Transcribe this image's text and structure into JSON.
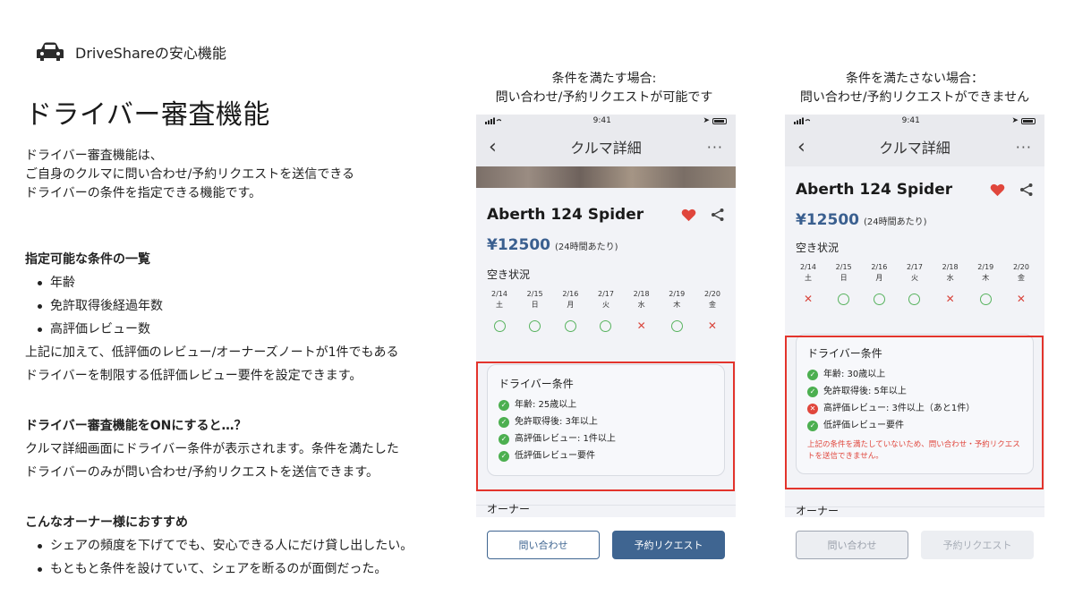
{
  "brand": {
    "name": "DriveShareの安心機能",
    "icon": "car-icon"
  },
  "page_title": "ドライバー審査機能",
  "intro": [
    "ドライバー審査機能は、",
    "ご自身のクルマに問い合わせ/予約リクエストを送信できる",
    "ドライバーの条件を指定できる機能です。"
  ],
  "section1": {
    "heading": "指定可能な条件の一覧",
    "items": [
      "年齢",
      "免許取得後経過年数",
      "高評価レビュー数"
    ],
    "notes": [
      "上記に加えて、低評価のレビュー/オーナーズノートが1件でもある",
      "ドライバーを制限する低評価レビュー要件を設定できます。"
    ]
  },
  "section2": {
    "heading": "ドライバー審査機能をONにすると…？",
    "lines": [
      "クルマ詳細画面にドライバー条件が表示されます。条件を満たした",
      "ドライバーのみが問い合わせ/予約リクエストを送信できます。"
    ]
  },
  "section3": {
    "heading": "こんなオーナー様におすすめ",
    "items": [
      "シェアの頻度を下げてでも、安心できる人にだけ貸し出したい。",
      "もともと条件を設けていて、シェアを断るのが面倒だった。"
    ]
  },
  "phone1": {
    "caption": [
      "条件を満たす場合:",
      "問い合わせ/予約リクエストが可能です"
    ],
    "time": "9:41",
    "nav_title": "クルマ詳細",
    "back": "‹",
    "more": "···",
    "car_name": "Aberth 124 Spider",
    "price": "¥12500",
    "price_note": "(24時間あたり)",
    "avail_label": "空き状況",
    "days": [
      {
        "date": "2/14",
        "dow": "土",
        "ok": true
      },
      {
        "date": "2/15",
        "dow": "日",
        "ok": true
      },
      {
        "date": "2/16",
        "dow": "月",
        "ok": true
      },
      {
        "date": "2/17",
        "dow": "火",
        "ok": true
      },
      {
        "date": "2/18",
        "dow": "水",
        "ok": false
      },
      {
        "date": "2/19",
        "dow": "木",
        "ok": true
      },
      {
        "date": "2/20",
        "dow": "金",
        "ok": false
      }
    ],
    "cond_title": "ドライバー条件",
    "conditions": [
      {
        "text": "年齢: 25歳以上",
        "ok": true
      },
      {
        "text": "免許取得後: 3年以上",
        "ok": true
      },
      {
        "text": "高評価レビュー: 1件以上",
        "ok": true
      },
      {
        "text": "低評価レビュー要件",
        "ok": true
      }
    ],
    "owner_label": "オーナー",
    "btn_inquiry": "問い合わせ",
    "btn_request": "予約リクエスト"
  },
  "phone2": {
    "caption": [
      "条件を満たさない場合：",
      "問い合わせ/予約リクエストができません"
    ],
    "time": "9:41",
    "nav_title": "クルマ詳細",
    "back": "‹",
    "more": "···",
    "car_name": "Aberth 124 Spider",
    "price": "¥12500",
    "price_note": "(24時間あたり)",
    "avail_label": "空き状況",
    "days": [
      {
        "date": "2/14",
        "dow": "土",
        "ok": false
      },
      {
        "date": "2/15",
        "dow": "日",
        "ok": true
      },
      {
        "date": "2/16",
        "dow": "月",
        "ok": true
      },
      {
        "date": "2/17",
        "dow": "火",
        "ok": true
      },
      {
        "date": "2/18",
        "dow": "水",
        "ok": false
      },
      {
        "date": "2/19",
        "dow": "木",
        "ok": true
      },
      {
        "date": "2/20",
        "dow": "金",
        "ok": false
      }
    ],
    "cond_title": "ドライバー条件",
    "conditions": [
      {
        "text": "年齢: 30歳以上",
        "ok": true
      },
      {
        "text": "免許取得後: 5年以上",
        "ok": true
      },
      {
        "text": "高評価レビュー: 3件以上（あと1件）",
        "ok": false
      },
      {
        "text": "低評価レビュー要件",
        "ok": true
      }
    ],
    "warning": "上記の条件を満たしていないため、問い合わせ・予約リクエストを送信できません。",
    "owner_label": "オーナー",
    "btn_inquiry": "問い合わせ",
    "btn_request": "予約リクエスト"
  },
  "colors": {
    "accent": "#3f6591",
    "ok": "#4caf50",
    "ng": "#e0463c",
    "highlight": "#e3342c",
    "heart": "#e0463c"
  }
}
